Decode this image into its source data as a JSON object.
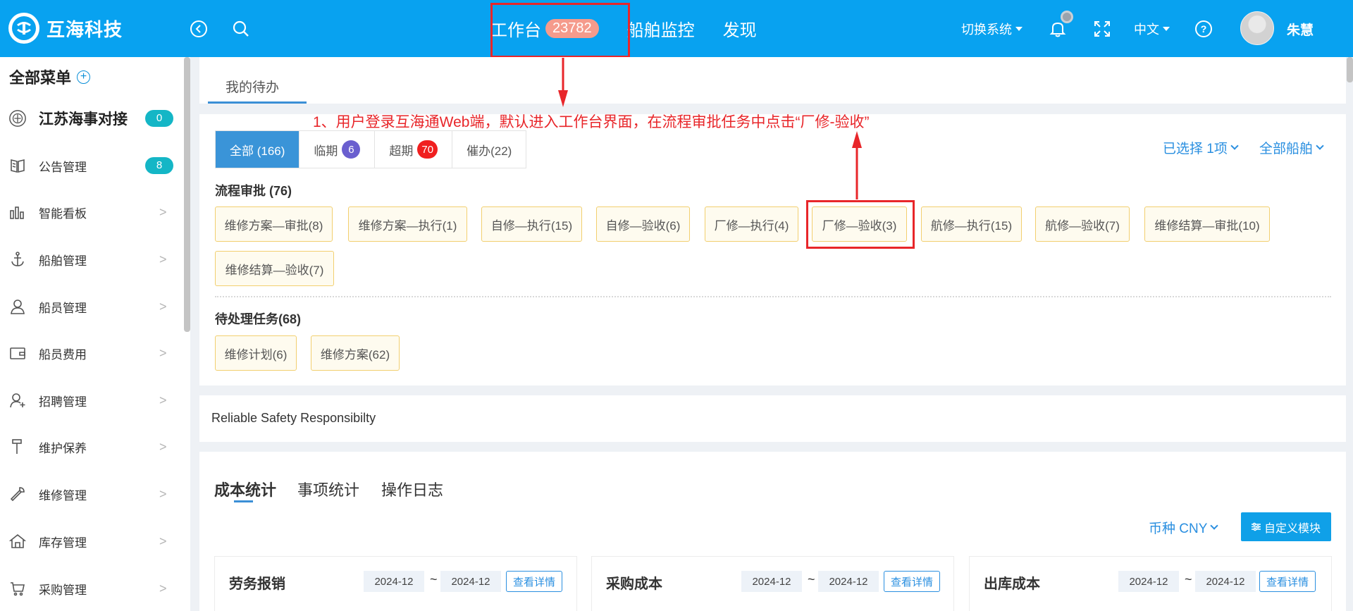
{
  "header": {
    "brand": "互海科技",
    "nav": [
      {
        "label": "工作台",
        "badge": "23782"
      },
      {
        "label": "船舶监控"
      },
      {
        "label": "发现"
      }
    ],
    "switch_system": "切换系统",
    "language": "中文",
    "username": "朱慧"
  },
  "sidebar": {
    "title": "全部菜单",
    "items": [
      {
        "label": "江苏海事对接",
        "badge": "0",
        "icon": "emblem-icon"
      },
      {
        "label": "公告管理",
        "badge": "8",
        "icon": "book-icon"
      },
      {
        "label": "智能看板",
        "icon": "bar-chart-icon"
      },
      {
        "label": "船舶管理",
        "icon": "anchor-icon"
      },
      {
        "label": "船员管理",
        "icon": "user-icon"
      },
      {
        "label": "船员费用",
        "icon": "wallet-icon"
      },
      {
        "label": "招聘管理",
        "icon": "user-add-icon"
      },
      {
        "label": "维护保养",
        "icon": "hammer-icon"
      },
      {
        "label": "维修管理",
        "icon": "wrench-icon"
      },
      {
        "label": "库存管理",
        "icon": "home-icon"
      },
      {
        "label": "采购管理",
        "icon": "cart-icon"
      }
    ]
  },
  "main": {
    "page_tab": "我的待办",
    "annotation": "1、用户登录互海通Web端，默认进入工作台界面，在流程审批任务中点击“厂修-验收”",
    "filters": [
      {
        "label": "全部 (166)"
      },
      {
        "label": "临期",
        "badge": "6",
        "badge_color": "#6a5fcf"
      },
      {
        "label": "超期",
        "badge": "70",
        "badge_color": "#f01f1f"
      },
      {
        "label": "催办(22)"
      }
    ],
    "selected": "已选择 1项",
    "all_ships": "全部船舶",
    "process_title": "流程审批 (76)",
    "process_chips": [
      "维修方案—审批(8)",
      "维修方案—执行(1)",
      "自修—执行(15)",
      "自修—验收(6)",
      "厂修—执行(4)",
      "厂修—验收(3)",
      "航修—执行(15)",
      "航修—验收(7)",
      "维修结算—审批(10)",
      "维修结算—验收(7)"
    ],
    "pending_title": "待处理任务(68)",
    "pending_chips": [
      "维修计划(6)",
      "维修方案(62)"
    ],
    "slogan": "Reliable Safety Responsibilty",
    "stat_tabs": [
      "成本统计",
      "事项统计",
      "操作日志"
    ],
    "currency": "币种 CNY",
    "custom_module": "自定义模块",
    "cost_cards": [
      {
        "title": "劳务报销",
        "from": "2024-12",
        "to": "2024-12",
        "detail": "查看详情"
      },
      {
        "title": "采购成本",
        "from": "2024-12",
        "to": "2024-12",
        "detail": "查看详情"
      },
      {
        "title": "出库成本",
        "from": "2024-12",
        "to": "2024-12",
        "detail": "查看详情"
      }
    ]
  }
}
